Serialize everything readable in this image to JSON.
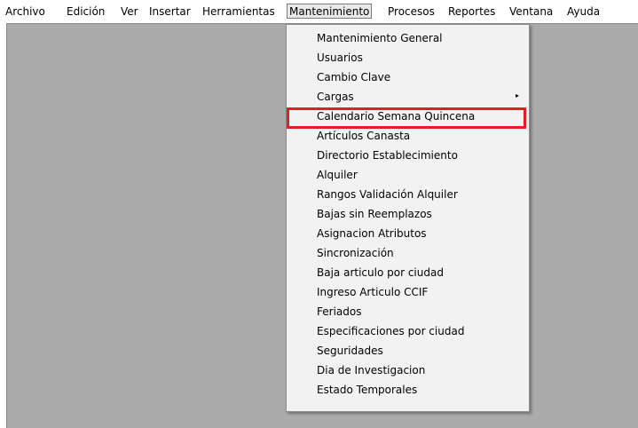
{
  "menubar": {
    "items": [
      {
        "label": "Archivo"
      },
      {
        "label": "Edición"
      },
      {
        "label": "Ver"
      },
      {
        "label": "Insertar"
      },
      {
        "label": "Herramientas"
      },
      {
        "label": "Mantenimiento"
      },
      {
        "label": "Procesos"
      },
      {
        "label": "Reportes"
      },
      {
        "label": "Ventana"
      },
      {
        "label": "Ayuda"
      }
    ]
  },
  "dropdown": {
    "items": [
      {
        "label": "Mantenimiento General"
      },
      {
        "label": "Usuarios"
      },
      {
        "label": "Cambio Clave"
      },
      {
        "label": "Cargas"
      },
      {
        "label": "Calendario Semana Quincena"
      },
      {
        "label": "Artículos Canasta"
      },
      {
        "label": "Directorio Establecimiento"
      },
      {
        "label": "Alquiler"
      },
      {
        "label": "Rangos Validación Alquiler"
      },
      {
        "label": "Bajas sin Reemplazos"
      },
      {
        "label": "Asignacion Atributos"
      },
      {
        "label": "Sincronización"
      },
      {
        "label": "Baja articulo por ciudad"
      },
      {
        "label": "Ingreso Articulo CCIF"
      },
      {
        "label": "Feriados"
      },
      {
        "label": "Especificaciones por ciudad"
      },
      {
        "label": "Seguridades"
      },
      {
        "label": "Dia de Investigacion"
      },
      {
        "label": "Estado Temporales"
      }
    ],
    "submenu_arrow": "▸",
    "highlight_color": "#e01e23"
  },
  "colors": {
    "workspace": "#ababab",
    "menu_background": "#f2f2f2",
    "menubar_background": "#ffffff"
  }
}
